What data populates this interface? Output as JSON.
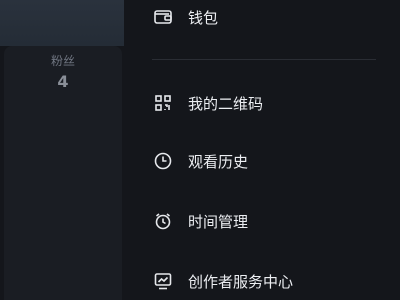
{
  "profile": {
    "stats": {
      "fans_label": "粉丝",
      "fans_value": "4"
    }
  },
  "drawer": {
    "items": [
      {
        "label": "钱包",
        "icon": "wallet-icon"
      },
      {
        "label": "我的二维码",
        "icon": "qr-code-icon"
      },
      {
        "label": "观看历史",
        "icon": "clock-icon"
      },
      {
        "label": "时间管理",
        "icon": "alarm-clock-icon"
      },
      {
        "label": "创作者服务中心",
        "icon": "creator-chart-icon"
      }
    ]
  }
}
